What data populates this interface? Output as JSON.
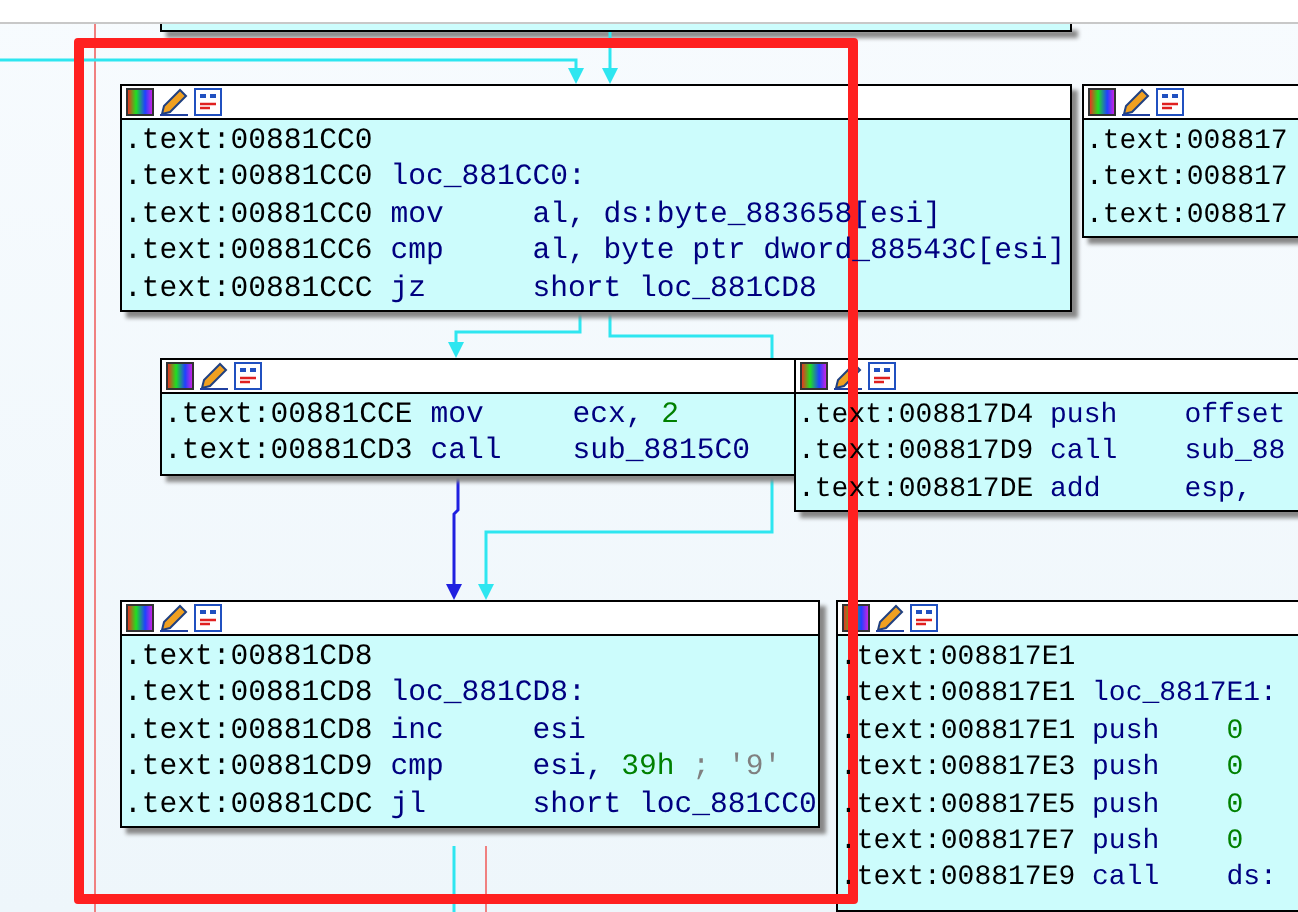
{
  "graph_nodes": [
    {
      "lines": [
        {
          "address": ".text:00881CC0"
        },
        {
          "address": ".text:00881CC0",
          "label": "loc_881CC0:"
        },
        {
          "address": ".text:00881CC0",
          "mnemonic": "mov",
          "operands": [
            {
              "text": "al, ds:byte_883658[esi]",
              "kind": "name"
            }
          ]
        },
        {
          "address": ".text:00881CC6",
          "mnemonic": "cmp",
          "operands": [
            {
              "text": "al, byte ptr dword_88543C[esi]",
              "kind": "name"
            }
          ]
        },
        {
          "address": ".text:00881CCC",
          "mnemonic": "jz",
          "operands": [
            {
              "text": "short loc_881CD8",
              "kind": "name"
            }
          ]
        }
      ]
    },
    {
      "lines": [
        {
          "address": ".text:008817"
        },
        {
          "address": ".text:008817"
        },
        {
          "address": ".text:008817"
        }
      ]
    },
    {
      "lines": [
        {
          "address": ".text:00881CCE",
          "mnemonic": "mov",
          "operands": [
            {
              "text": "ecx, ",
              "kind": "name"
            },
            {
              "text": "2",
              "kind": "num"
            }
          ]
        },
        {
          "address": ".text:00881CD3",
          "mnemonic": "call",
          "operands": [
            {
              "text": "sub_8815C0",
              "kind": "name"
            }
          ]
        }
      ]
    },
    {
      "lines": [
        {
          "address": ".text:008817D4",
          "mnemonic": "push",
          "operands": [
            {
              "text": "offset",
              "kind": "name"
            }
          ]
        },
        {
          "address": ".text:008817D9",
          "mnemonic": "call",
          "operands": [
            {
              "text": "sub_88",
              "kind": "name"
            }
          ]
        },
        {
          "address": ".text:008817DE",
          "mnemonic": "add",
          "operands": [
            {
              "text": "esp,",
              "kind": "name"
            }
          ]
        }
      ]
    },
    {
      "lines": [
        {
          "address": ".text:00881CD8"
        },
        {
          "address": ".text:00881CD8",
          "label": "loc_881CD8:"
        },
        {
          "address": ".text:00881CD8",
          "mnemonic": "inc",
          "operands": [
            {
              "text": "esi",
              "kind": "name"
            }
          ]
        },
        {
          "address": ".text:00881CD9",
          "mnemonic": "cmp",
          "operands": [
            {
              "text": "esi, ",
              "kind": "name"
            },
            {
              "text": "39h",
              "kind": "num"
            },
            {
              "text": " ; '9'",
              "kind": "comment"
            }
          ]
        },
        {
          "address": ".text:00881CDC",
          "mnemonic": "jl",
          "operands": [
            {
              "text": "short loc_881CC0",
              "kind": "name"
            }
          ]
        }
      ]
    },
    {
      "lines": [
        {
          "address": ".text:008817E1"
        },
        {
          "address": ".text:008817E1",
          "label": "loc_8817E1:"
        },
        {
          "address": ".text:008817E1",
          "mnemonic": "push",
          "operands": [
            {
              "text": "0",
              "kind": "num"
            }
          ]
        },
        {
          "address": ".text:008817E3",
          "mnemonic": "push",
          "operands": [
            {
              "text": "0",
              "kind": "num"
            }
          ]
        },
        {
          "address": ".text:008817E5",
          "mnemonic": "push",
          "operands": [
            {
              "text": "0",
              "kind": "num"
            }
          ]
        },
        {
          "address": ".text:008817E7",
          "mnemonic": "push",
          "operands": [
            {
              "text": "0",
              "kind": "num"
            }
          ]
        },
        {
          "address": ".text:008817E9",
          "mnemonic": "call",
          "operands": [
            {
              "text": "ds:",
              "kind": "name"
            }
          ]
        }
      ]
    }
  ]
}
